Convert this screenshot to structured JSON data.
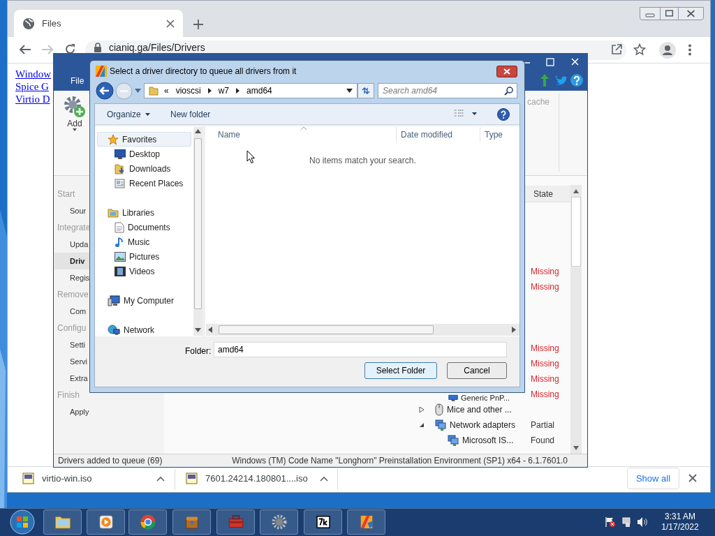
{
  "browser": {
    "tab_title": "Files",
    "address": "cianiq.ga/Files/Drivers",
    "links": [
      "Window",
      "Spice G",
      "Virtio D"
    ]
  },
  "app": {
    "menu_tab": "File",
    "add_label": "Add",
    "ribbon_text": "cache",
    "nav": [
      {
        "label": "Start",
        "children": [
          {
            "label": "Sour",
            "selected": false
          }
        ]
      },
      {
        "label": "Integrate",
        "children": [
          {
            "label": "Upda",
            "selected": false
          },
          {
            "label": "Driv",
            "selected": true
          },
          {
            "label": "Regis",
            "selected": false
          }
        ]
      },
      {
        "label": "Remove",
        "children": [
          {
            "label": "Com",
            "selected": false
          }
        ]
      },
      {
        "label": "Configu",
        "children": [
          {
            "label": "Setti",
            "selected": false
          },
          {
            "label": "Servi",
            "selected": false
          },
          {
            "label": "Extra",
            "selected": false
          }
        ]
      },
      {
        "label": "Finish",
        "children": [
          {
            "label": "Apply",
            "selected": false
          }
        ]
      }
    ],
    "state_column": "State",
    "tree": [
      {
        "children": [
          {
            "state": "Missing",
            "color": "#d9262c"
          },
          {
            "state": "Missing",
            "color": "#d9262c"
          }
        ]
      },
      {
        "children": [
          {
            "state": "Missing",
            "color": "#d9262c"
          },
          {
            "state": "Missing",
            "color": "#d9262c"
          },
          {
            "state": "Missing",
            "color": "#d9262c"
          },
          {
            "name": "Generic PnP...",
            "state": "Missing",
            "color": "#d9262c"
          }
        ]
      },
      {
        "name": "Mice and other ...",
        "expanded": false
      },
      {
        "name": "Network adapters",
        "state": "Partial",
        "color": "#333333",
        "expanded": true,
        "children": [
          {
            "name": "Microsoft IS...",
            "state": "Found",
            "color": "#333333"
          }
        ]
      }
    ],
    "status_left": "Drivers added to queue (69)",
    "status_right": "Windows (TM) Code Name \"Longhorn\" Preinstallation Environment (SP1) x64 - 6.1.7601.0"
  },
  "dialog": {
    "title": "Select a driver directory to queue all drivers from it",
    "overflow": "«",
    "breadcrumb": [
      "vioscsi",
      "w7",
      "amd64"
    ],
    "search_placeholder": "Search amd64",
    "organize": "Organize",
    "new_folder": "New folder",
    "nav": [
      {
        "label": "Favorites",
        "selected": true,
        "children": [
          {
            "label": "Desktop",
            "selected": false
          },
          {
            "label": "Downloads",
            "selected": false
          },
          {
            "label": "Recent Places",
            "selected": false
          }
        ]
      },
      {
        "label": "Libraries",
        "selected": false,
        "children": [
          {
            "label": "Documents",
            "selected": false
          },
          {
            "label": "Music",
            "selected": false
          },
          {
            "label": "Pictures",
            "selected": false
          },
          {
            "label": "Videos",
            "selected": false
          }
        ]
      },
      {
        "label": "My Computer",
        "selected": false
      },
      {
        "label": "Network",
        "selected": false
      }
    ],
    "columns": [
      "Name",
      "Date modified",
      "Type"
    ],
    "empty_message": "No items match your search.",
    "folder_label": "Folder:",
    "folder_value": "amd64",
    "buttons": [
      "Select Folder",
      "Cancel"
    ]
  },
  "downloads": {
    "items": [
      {
        "name": "virtio-win.iso"
      },
      {
        "name": "7601.24214.180801....iso"
      }
    ],
    "show_all": "Show all"
  },
  "taskbar": {
    "time": "3:31 AM",
    "date": "1/17/2022"
  }
}
